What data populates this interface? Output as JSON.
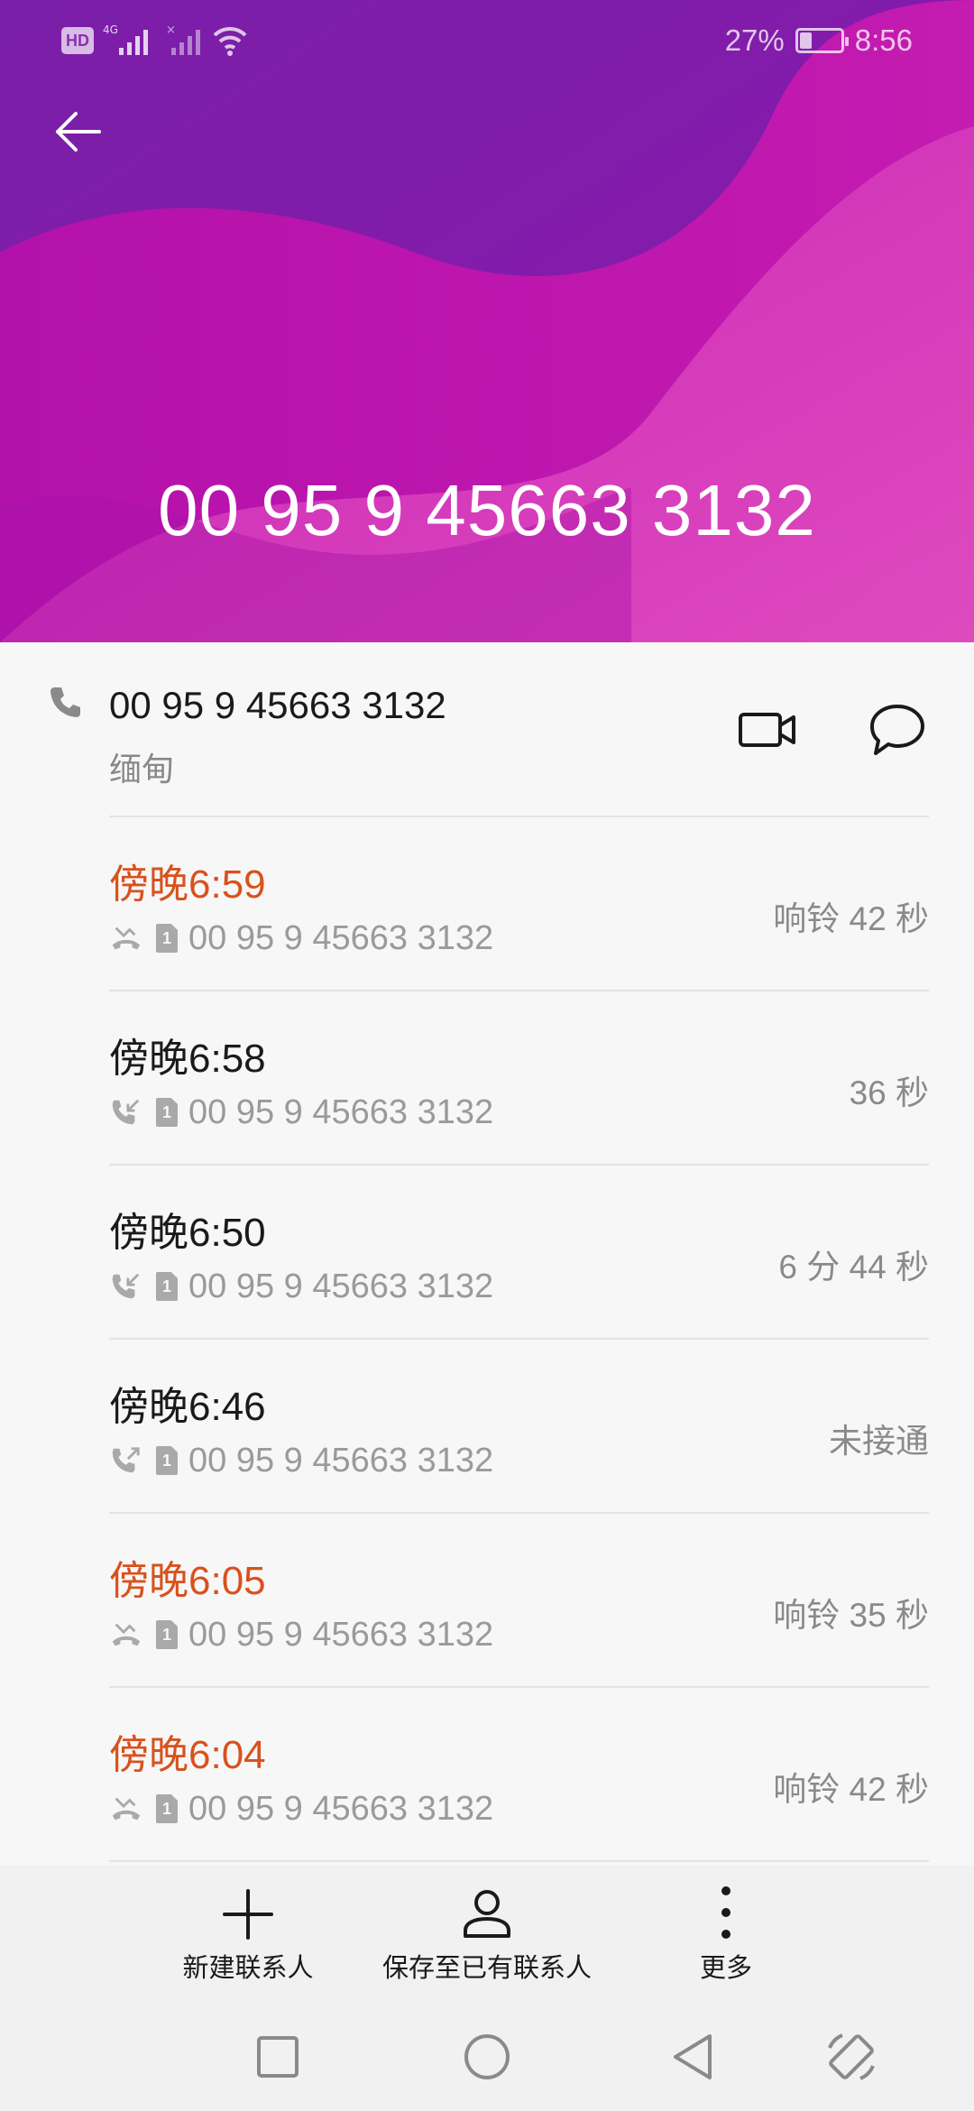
{
  "status_bar": {
    "hd_label": "HD",
    "network_label": "4G",
    "battery_text": "27%",
    "battery_level": 0.27,
    "time": "8:56"
  },
  "header": {
    "title_number": "00 95 9 45663 3132",
    "gradient_colors": [
      "#7d1ea6",
      "#b010a8",
      "#e040b8"
    ]
  },
  "contact": {
    "number": "00 95 9 45663 3132",
    "location": "缅甸",
    "actions": [
      {
        "name": "video-call",
        "icon": "video-camera-icon"
      },
      {
        "name": "message",
        "icon": "chat-bubble-icon"
      }
    ]
  },
  "call_log": [
    {
      "time": "傍晚6:59",
      "type": "missed",
      "icon": "missed-call-icon",
      "sim": "1",
      "number": "00 95 9 45663 3132",
      "duration": "响铃 42 秒"
    },
    {
      "time": "傍晚6:58",
      "type": "incoming",
      "icon": "incoming-call-icon",
      "sim": "1",
      "number": "00 95 9 45663 3132",
      "duration": "36 秒"
    },
    {
      "time": "傍晚6:50",
      "type": "incoming",
      "icon": "incoming-call-icon",
      "sim": "1",
      "number": "00 95 9 45663 3132",
      "duration": "6 分 44 秒"
    },
    {
      "time": "傍晚6:46",
      "type": "outgoing",
      "icon": "outgoing-call-icon",
      "sim": "1",
      "number": "00 95 9 45663 3132",
      "duration": "未接通"
    },
    {
      "time": "傍晚6:05",
      "type": "missed",
      "icon": "missed-call-icon",
      "sim": "1",
      "number": "00 95 9 45663 3132",
      "duration": "响铃 35 秒"
    },
    {
      "time": "傍晚6:04",
      "type": "missed",
      "icon": "missed-call-icon",
      "sim": "1",
      "number": "00 95 9 45663 3132",
      "duration": "响铃 42 秒"
    }
  ],
  "bottom_actions": {
    "new_contact": "新建联系人",
    "save_existing": "保存至已有联系人",
    "more": "更多"
  },
  "colors": {
    "missed": "#d9511c",
    "accent": "#b010a8"
  }
}
